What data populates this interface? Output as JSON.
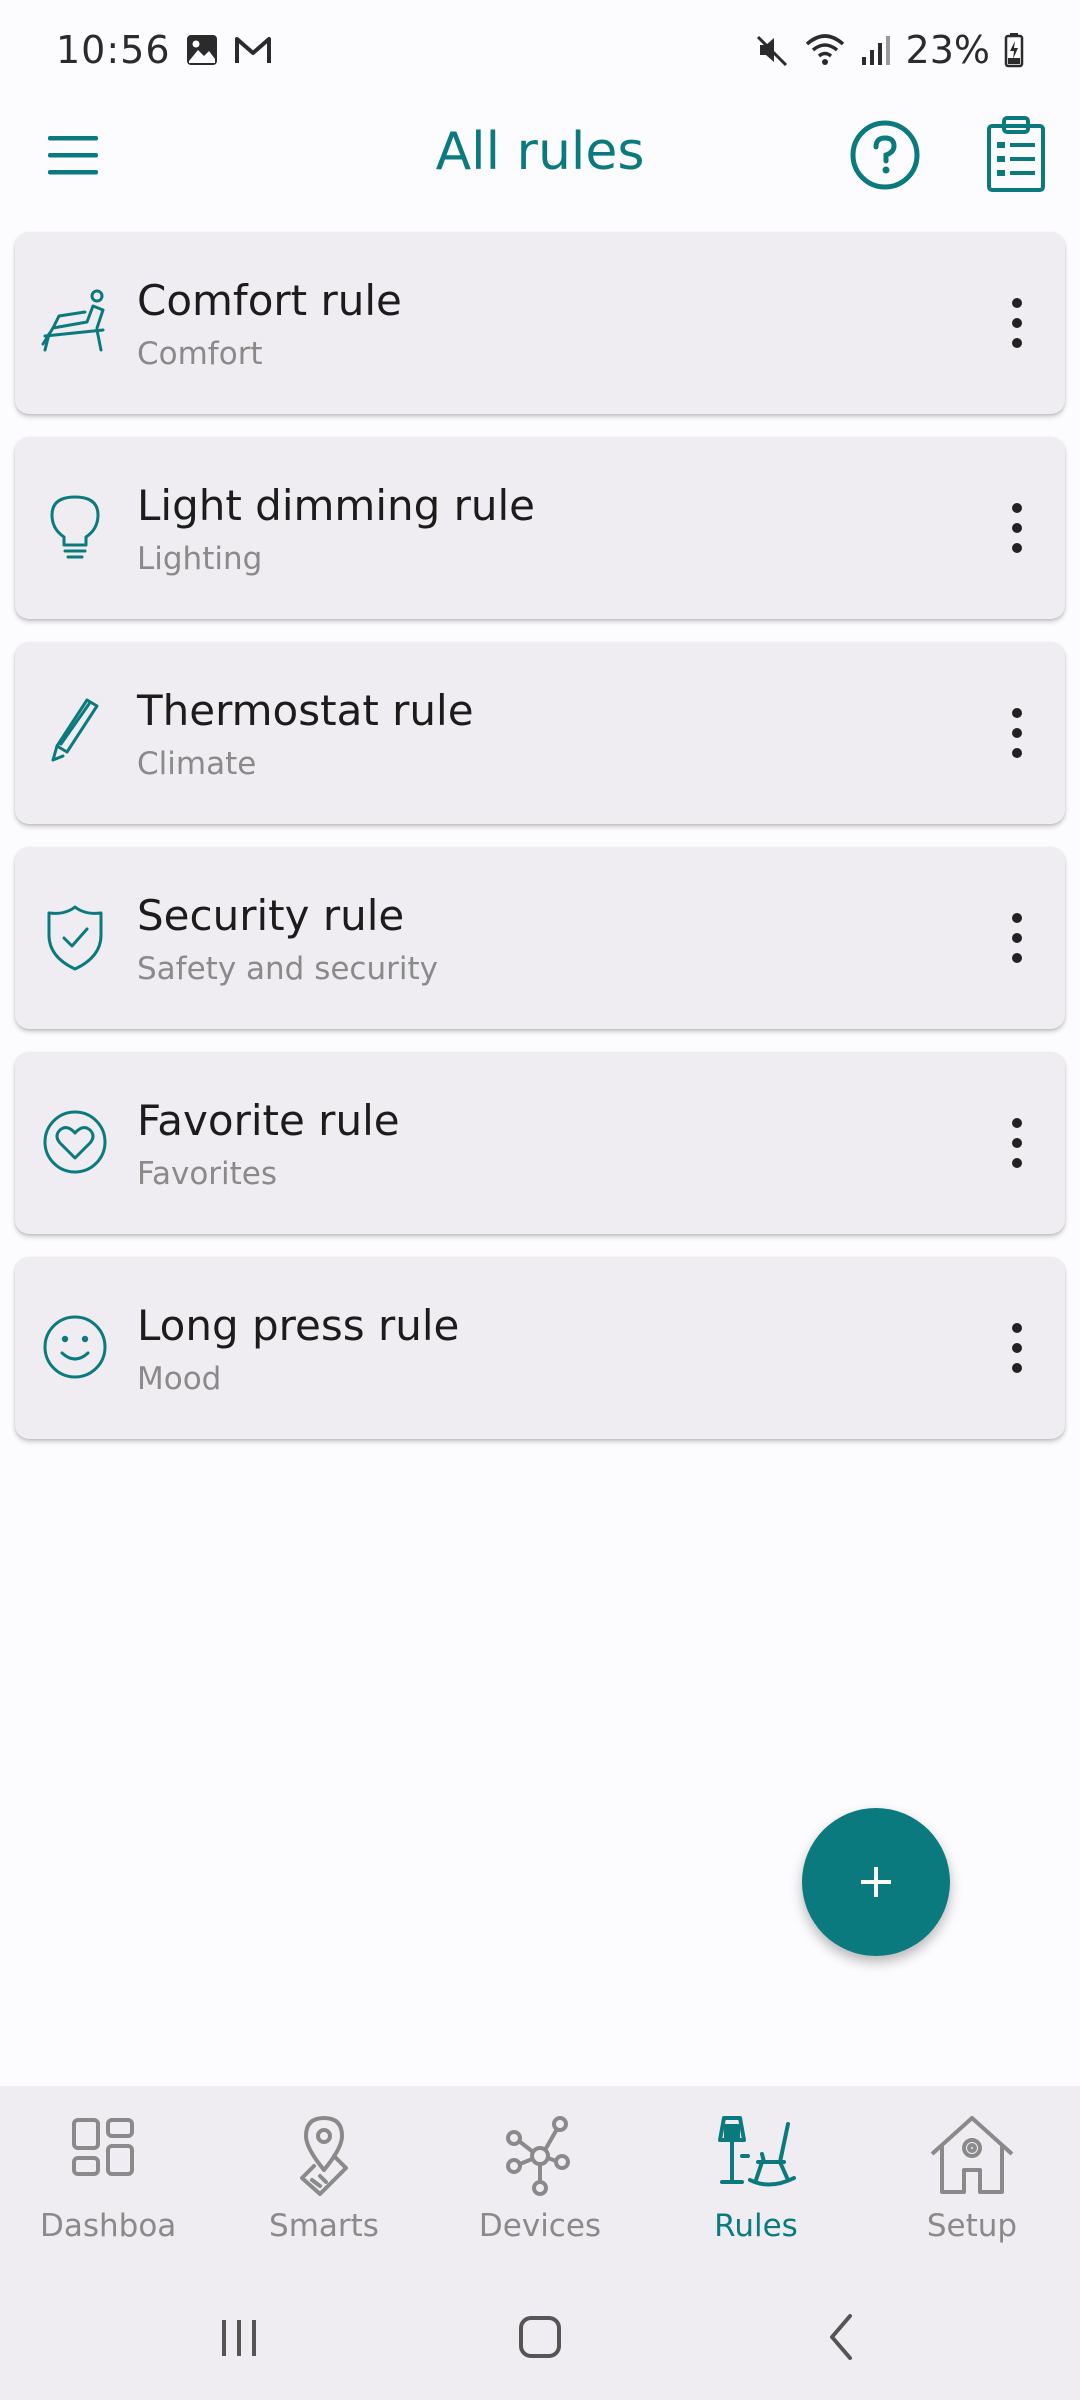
{
  "status_bar": {
    "time": "10:56",
    "battery": "23%"
  },
  "app_bar": {
    "title": "All rules"
  },
  "rules": [
    {
      "name": "Comfort rule",
      "category": "Comfort",
      "icon": "lounge-chair-icon"
    },
    {
      "name": "Light dimming rule",
      "category": "Lighting",
      "icon": "lightbulb-icon"
    },
    {
      "name": "Thermostat rule",
      "category": "Climate",
      "icon": "thermometer-icon"
    },
    {
      "name": "Security rule",
      "category": "Safety and security",
      "icon": "shield-check-icon"
    },
    {
      "name": "Favorite rule",
      "category": "Favorites",
      "icon": "heart-circle-icon"
    },
    {
      "name": "Long press rule",
      "category": "Mood",
      "icon": "smiley-icon"
    }
  ],
  "fab": {
    "label": "+"
  },
  "bottom_nav": {
    "items": [
      {
        "label": "Dashboard",
        "icon": "dashboard-grid-icon",
        "active": false
      },
      {
        "label": "Smarts",
        "icon": "location-pin-icon",
        "active": false
      },
      {
        "label": "Devices",
        "icon": "network-nodes-icon",
        "active": false
      },
      {
        "label": "Rules",
        "icon": "lamp-rocking-chair-icon",
        "active": true
      },
      {
        "label": "Setup",
        "icon": "house-gear-icon",
        "active": false
      }
    ]
  },
  "colors": {
    "accent": "#0b7a7f",
    "card_bg": "#efedf1",
    "page_bg": "#fcfbfd",
    "muted_text": "#8a8a8a"
  }
}
